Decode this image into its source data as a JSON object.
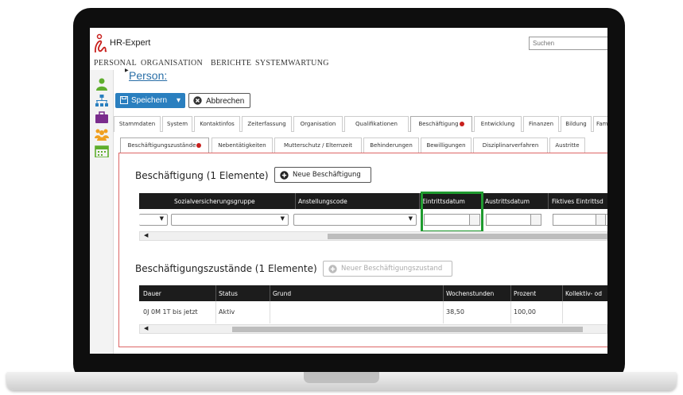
{
  "app": {
    "title": "HR-Expert"
  },
  "search": {
    "placeholder": "Suchen"
  },
  "menu": [
    "Personal",
    "Organisation",
    "Berichte",
    "Systemwartung"
  ],
  "page": {
    "title": "Person:"
  },
  "toolbar": {
    "save_label": "Speichern",
    "cancel_label": "Abbrechen"
  },
  "tabs_main": [
    "Stammdaten",
    "System",
    "Kontaktinfos",
    "Zeiterfassung",
    "Organisation",
    "Qualifikationen",
    "Beschäftigung",
    "Entwicklung",
    "Finanzen",
    "Bildung",
    "Fam"
  ],
  "tabs_sub": [
    "Beschäftigungszustände",
    "Nebentätigkeiten",
    "Mutterschutz / Elternzeit",
    "Behinderungen",
    "Bewilligungen",
    "Disziplinarverfahren",
    "Austritte"
  ],
  "employment": {
    "title": "Beschäftigung (1 Elemente)",
    "new_button": "Neue Beschäftigung",
    "columns": [
      "Sozialversicherungsgruppe",
      "Anstellungscode",
      "Eintrittsdatum",
      "Austrittsdatum",
      "Fiktives Eintrittsd"
    ]
  },
  "states": {
    "title": "Beschäftigungszustände (1 Elemente)",
    "new_button": "Neuer Beschäftigungszustand",
    "columns": [
      "Dauer",
      "Status",
      "Grund",
      "Wochenstunden",
      "Prozent",
      "Kollektiv- od"
    ],
    "rows": [
      {
        "dauer": "0J 0M 1T bis jetzt",
        "status": "Aktiv",
        "grund": "",
        "wochenstunden": "38,50",
        "prozent": "100,00"
      }
    ]
  },
  "colors": {
    "accent": "#2a7fbf",
    "highlight": "#1f9b2f",
    "alert": "#c8201d",
    "header_dark": "#1c1c1c"
  }
}
